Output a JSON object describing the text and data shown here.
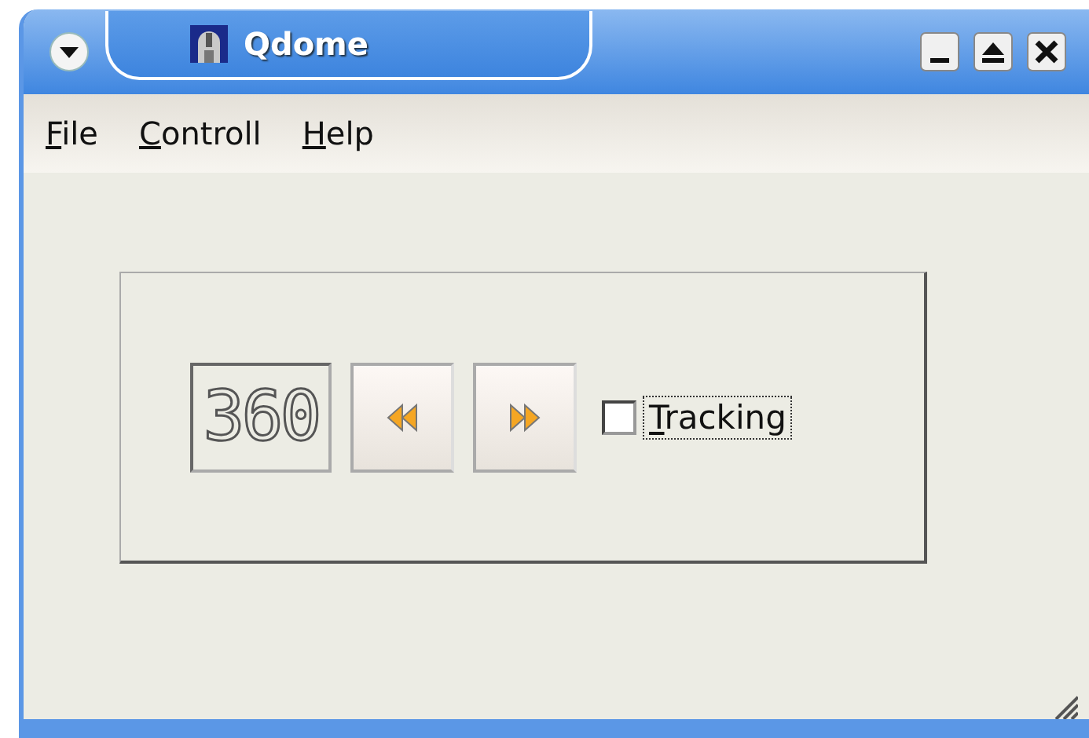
{
  "window": {
    "title": "Qdome"
  },
  "menu": [
    {
      "label": "File"
    },
    {
      "label": "Controll"
    },
    {
      "label": "Help"
    }
  ],
  "display": {
    "value": "360"
  },
  "tracking": {
    "label": "Tracking",
    "checked": false
  }
}
